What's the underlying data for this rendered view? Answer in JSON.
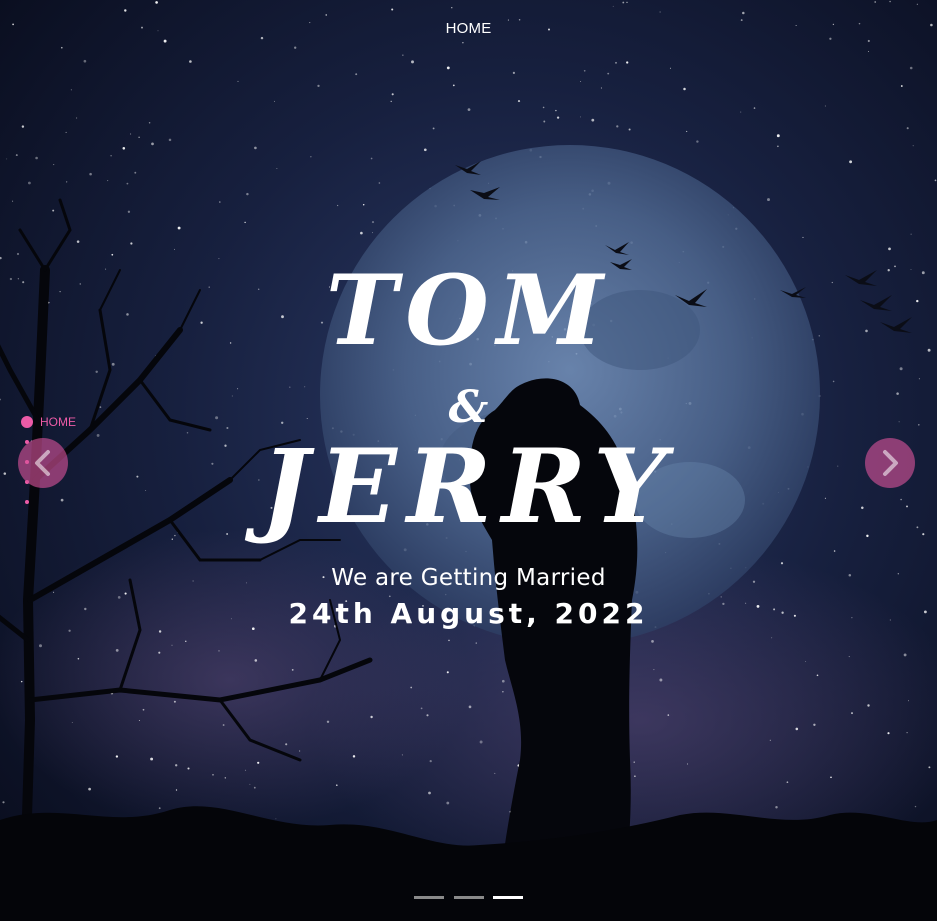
{
  "nav": {
    "home_label": "HOME"
  },
  "hero": {
    "name_1": "TOM",
    "ampersand": "&",
    "name_2": "JERRY",
    "subtitle": "We are Getting Married",
    "date": "24th August, 2022"
  },
  "side_nav": {
    "items": [
      {
        "label": "HOME",
        "active": true
      },
      {
        "label": "",
        "active": false
      },
      {
        "label": "",
        "active": false
      },
      {
        "label": "",
        "active": false
      },
      {
        "label": "",
        "active": false
      }
    ]
  },
  "carousel": {
    "prev_icon": "chevron-left-icon",
    "next_icon": "chevron-right-icon",
    "slide_count": 3,
    "active_slide": 3
  },
  "colors": {
    "accent": "#ec5ba7",
    "arrow_bg": "rgba(215,82,154,0.62)",
    "sky_dark": "#05070f",
    "sky_blue": "#1b2547",
    "moon": "#5c7aa6"
  }
}
